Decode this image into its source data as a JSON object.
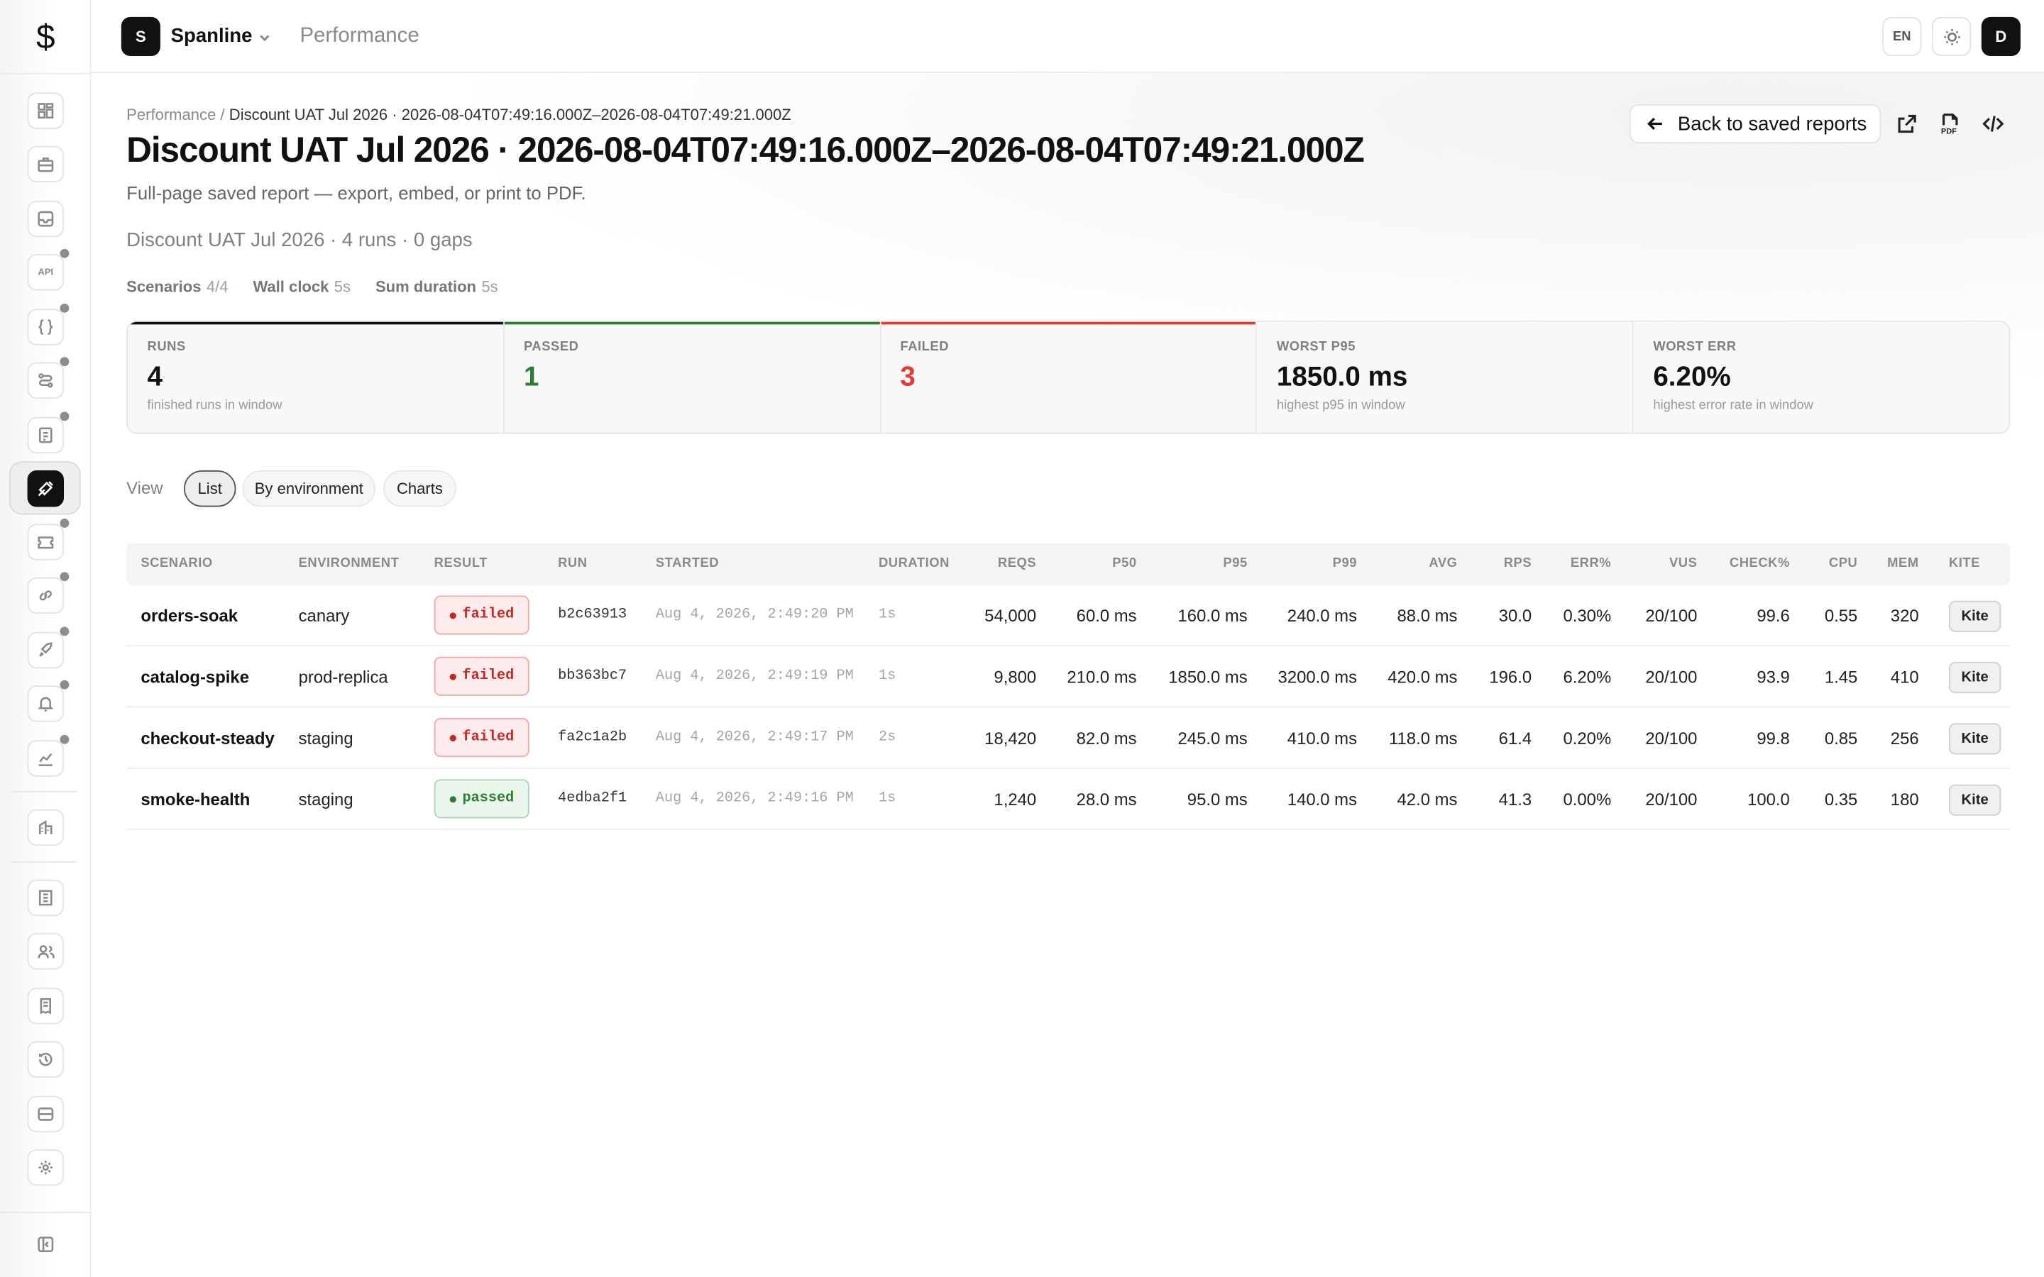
{
  "app": {
    "logo_glyph": "$"
  },
  "workspace": {
    "avatar_letter": "S",
    "name": "Spanline"
  },
  "topbar": {
    "section": "Performance",
    "lang": "EN",
    "user_initial": "D"
  },
  "breadcrumb": {
    "parent": "Performance",
    "separator": "/",
    "current": "Discount UAT Jul 2026 · 2026-08-04T07:49:16.000Z–2026-08-04T07:49:21.000Z"
  },
  "header": {
    "title": "Discount UAT Jul 2026 · 2026-08-04T07:49:16.000Z–2026-08-04T07:49:21.000Z",
    "subtitle": "Full-page saved report — export, embed, or print to PDF.",
    "summary": "Discount UAT Jul 2026 · 4 runs · 0 gaps",
    "back_label": "Back to saved reports"
  },
  "meta": [
    {
      "key": "Scenarios",
      "value": "4/4"
    },
    {
      "key": "Wall clock",
      "value": "5s"
    },
    {
      "key": "Sum duration",
      "value": "5s"
    }
  ],
  "stats": [
    {
      "label": "RUNS",
      "value": "4",
      "desc": "finished runs in window",
      "color": "#111111",
      "accent": "#111111"
    },
    {
      "label": "PASSED",
      "value": "1",
      "desc": "",
      "color": "#2e7d32",
      "accent": "#2e7d32"
    },
    {
      "label": "FAILED",
      "value": "3",
      "desc": "",
      "color": "#e53935",
      "accent": "#e53935"
    },
    {
      "label": "WORST P95",
      "value": "1850.0 ms",
      "desc": "highest p95 in window",
      "color": "#111111",
      "accent": ""
    },
    {
      "label": "WORST ERR",
      "value": "6.20%",
      "desc": "highest error rate in window",
      "color": "#111111",
      "accent": ""
    }
  ],
  "view": {
    "label": "View",
    "options": [
      "List",
      "By environment",
      "Charts"
    ],
    "selected": "List"
  },
  "table": {
    "columns": [
      "SCENARIO",
      "ENVIRONMENT",
      "RESULT",
      "RUN",
      "STARTED",
      "DURATION",
      "REQS",
      "P50",
      "P95",
      "P99",
      "AVG",
      "RPS",
      "ERR%",
      "VUS",
      "CHECK%",
      "CPU",
      "MEM",
      "KITE"
    ],
    "rows": [
      {
        "scenario": "orders-soak",
        "environment": "canary",
        "result": "failed",
        "run": "b2c63913",
        "started": "Aug 4, 2026, 2:49:20 PM",
        "duration": "1s",
        "reqs": "54,000",
        "p50": "60.0 ms",
        "p95": "160.0 ms",
        "p99": "240.0 ms",
        "avg": "88.0 ms",
        "rps": "30.0",
        "err": "0.30%",
        "vus": "20/100",
        "check": "99.6",
        "cpu": "0.55",
        "mem": "320",
        "kite": "Kite"
      },
      {
        "scenario": "catalog-spike",
        "environment": "prod-replica",
        "result": "failed",
        "run": "bb363bc7",
        "started": "Aug 4, 2026, 2:49:19 PM",
        "duration": "1s",
        "reqs": "9,800",
        "p50": "210.0 ms",
        "p95": "1850.0 ms",
        "p99": "3200.0 ms",
        "avg": "420.0 ms",
        "rps": "196.0",
        "err": "6.20%",
        "vus": "20/100",
        "check": "93.9",
        "cpu": "1.45",
        "mem": "410",
        "kite": "Kite"
      },
      {
        "scenario": "checkout-steady",
        "environment": "staging",
        "result": "failed",
        "run": "fa2c1a2b",
        "started": "Aug 4, 2026, 2:49:17 PM",
        "duration": "2s",
        "reqs": "18,420",
        "p50": "82.0 ms",
        "p95": "245.0 ms",
        "p99": "410.0 ms",
        "avg": "118.0 ms",
        "rps": "61.4",
        "err": "0.20%",
        "vus": "20/100",
        "check": "99.8",
        "cpu": "0.85",
        "mem": "256",
        "kite": "Kite"
      },
      {
        "scenario": "smoke-health",
        "environment": "staging",
        "result": "passed",
        "run": "4edba2f1",
        "started": "Aug 4, 2026, 2:49:16 PM",
        "duration": "1s",
        "reqs": "1,240",
        "p50": "28.0 ms",
        "p95": "95.0 ms",
        "p99": "140.0 ms",
        "avg": "42.0 ms",
        "rps": "41.3",
        "err": "0.00%",
        "vus": "20/100",
        "check": "100.0",
        "cpu": "0.35",
        "mem": "180",
        "kite": "Kite"
      }
    ]
  },
  "sidebar": {
    "icons": [
      "dashboard-icon",
      "briefcase-icon",
      "inbox-icon",
      "api-icon",
      "braces-icon",
      "workflow-icon",
      "clipboard-icon",
      "performance-icon",
      "ticket-icon",
      "link-icon",
      "rocket-icon",
      "bell-icon",
      "chart-icon",
      "building-icon",
      "ledger-icon",
      "users-icon",
      "receipt-icon",
      "history-icon",
      "storage-icon",
      "settings-icon",
      "collapse-sidebar-icon"
    ],
    "api_text": "API"
  }
}
